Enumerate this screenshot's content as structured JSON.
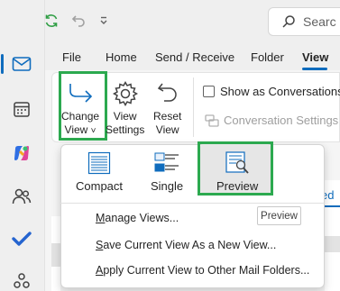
{
  "ribbon_tabs": [
    {
      "label": "File"
    },
    {
      "label": "Home"
    },
    {
      "label": "Send / Receive"
    },
    {
      "label": "Folder"
    },
    {
      "label": "View",
      "active": true
    }
  ],
  "search": {
    "placeholder": "Searc"
  },
  "ribbon": {
    "change_view": {
      "line1": "Change",
      "line2": "View",
      "caret": "˅"
    },
    "view_settings": {
      "line1": "View",
      "line2": "Settings"
    },
    "reset_view": {
      "line1": "Reset",
      "line2": "View"
    },
    "show_as_conversations": {
      "label": "Show as Conversations",
      "checked": false
    },
    "conversation_settings": {
      "label": "Conversation Settings",
      "caret": "˅",
      "enabled": false
    }
  },
  "dropdown": {
    "layouts": [
      {
        "label": "Compact"
      },
      {
        "label": "Single"
      },
      {
        "label": "Preview",
        "selected": true
      }
    ],
    "menu_items": [
      {
        "label": "Manage Views...",
        "underline": "M",
        "rest": "anage Views..."
      },
      {
        "label": "Save Current View As a New View...",
        "underline": "S",
        "rest": "ave Current View As a New View..."
      },
      {
        "label": "Apply Current View to Other Mail Folders...",
        "underline": "A",
        "rest": "pply Current View to Other Mail Folders..."
      }
    ]
  },
  "tooltip": {
    "text": "Preview"
  },
  "background": {
    "tab_fragment": "ed"
  },
  "colors": {
    "accent": "#0f6cbd",
    "highlight_box": "#2ca94f",
    "outlook_blue": "#0f6cbd",
    "todo_blue": "#2564cf"
  },
  "rail_icons": [
    "mail-icon",
    "calendar-icon",
    "copilot-icon",
    "people-icon",
    "todo-icon",
    "apps-icon"
  ]
}
